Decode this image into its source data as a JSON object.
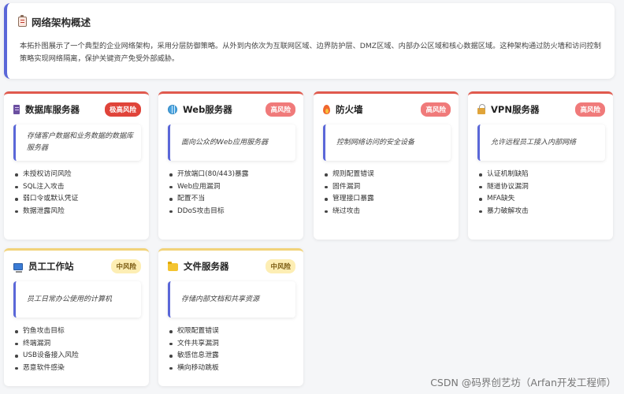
{
  "overview": {
    "title": "网络架构概述",
    "icon": "clipboard-icon",
    "description": "本拓扑图展示了一个典型的企业网络架构，采用分层防御策略。从外到内依次为互联网区域、边界防护层、DMZ区域、内部办公区域和核心数据区域。这种架构通过防火墙和访问控制策略实现网络隔离，保护关键资产免受外部威胁。"
  },
  "colors": {
    "accent": "#5a67d8",
    "critical": "#e0443a",
    "high": "#f07a7a",
    "medium": "#fdeeb4"
  },
  "cards": [
    {
      "title": "数据库服务器",
      "icon": "database-icon",
      "badge": "极高风险",
      "level": "critical",
      "description": "存储客户数据和业务数据的数据库服务器",
      "risks": [
        "未授权访问风险",
        "SQL注入攻击",
        "弱口令或默认凭证",
        "数据泄露风险"
      ]
    },
    {
      "title": "Web服务器",
      "icon": "globe-icon",
      "badge": "高风险",
      "level": "high",
      "description": "面向公众的Web应用服务器",
      "risks": [
        "开放端口(80/443)暴露",
        "Web应用漏洞",
        "配置不当",
        "DDoS攻击目标"
      ]
    },
    {
      "title": "防火墙",
      "icon": "fire-icon",
      "badge": "高风险",
      "level": "high",
      "description": "控制网络访问的安全设备",
      "risks": [
        "规则配置错误",
        "固件漏洞",
        "管理接口暴露",
        "绕过攻击"
      ]
    },
    {
      "title": "VPN服务器",
      "icon": "lock-icon",
      "badge": "高风险",
      "level": "high",
      "description": "允许远程员工接入内部网络",
      "risks": [
        "认证机制缺陷",
        "隧道协议漏洞",
        "MFA缺失",
        "暴力破解攻击"
      ]
    },
    {
      "title": "员工工作站",
      "icon": "computer-icon",
      "badge": "中风险",
      "level": "medium",
      "description": "员工日常办公使用的计算机",
      "risks": [
        "钓鱼攻击目标",
        "终端漏洞",
        "USB设备接入风险",
        "恶意软件感染"
      ]
    },
    {
      "title": "文件服务器",
      "icon": "folder-icon",
      "badge": "中风险",
      "level": "medium",
      "description": "存储内部文档和共享资源",
      "risks": [
        "权限配置错误",
        "文件共享漏洞",
        "敏感信息泄露",
        "横向移动跳板"
      ]
    }
  ],
  "watermark": "CSDN @码界创艺坊（Arfan开发工程师）"
}
